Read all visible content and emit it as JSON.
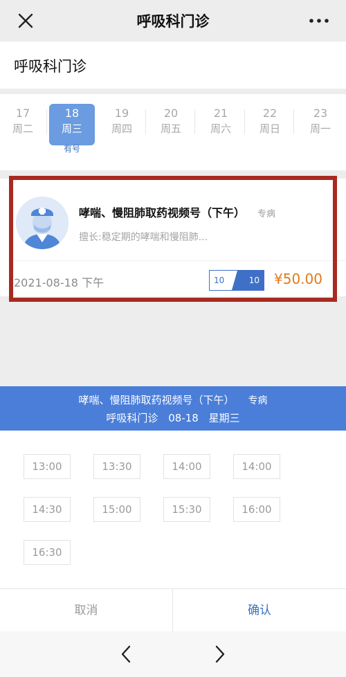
{
  "nav": {
    "title": "呼吸科门诊",
    "close_icon": "close-icon",
    "more_icon": "more-icon"
  },
  "department": {
    "name": "呼吸科门诊"
  },
  "dates": [
    {
      "day": "17",
      "weekday": "周二"
    },
    {
      "day": "18",
      "weekday": "周三",
      "selected": true,
      "status": "有号"
    },
    {
      "day": "19",
      "weekday": "周四"
    },
    {
      "day": "20",
      "weekday": "周五"
    },
    {
      "day": "21",
      "weekday": "周六"
    },
    {
      "day": "22",
      "weekday": "周日"
    },
    {
      "day": "23",
      "weekday": "周一"
    }
  ],
  "card": {
    "name": "哮喘、慢阻肺取药视频号（下午）",
    "type": "专病",
    "specialty": "擅长:稳定期的哮喘和慢阻肺...",
    "date": "2021-08-18 下午",
    "quota_remaining": "10",
    "quota_total": "10",
    "price": "¥50.00"
  },
  "summary": {
    "line1_name": "哮喘、慢阻肺取药视频号（下午）",
    "line1_type": "专病",
    "dept": "呼吸科门诊",
    "date": "08-18",
    "weekday": "星期三"
  },
  "slots": [
    "13:00",
    "13:30",
    "14:00",
    "14:00",
    "14:30",
    "15:00",
    "15:30",
    "16:00",
    "16:30"
  ],
  "actions": {
    "cancel": "取消",
    "confirm": "确认"
  },
  "colors": {
    "accent": "#4a7ed8",
    "price": "#e07a1d",
    "highlight": "#a82a20"
  }
}
